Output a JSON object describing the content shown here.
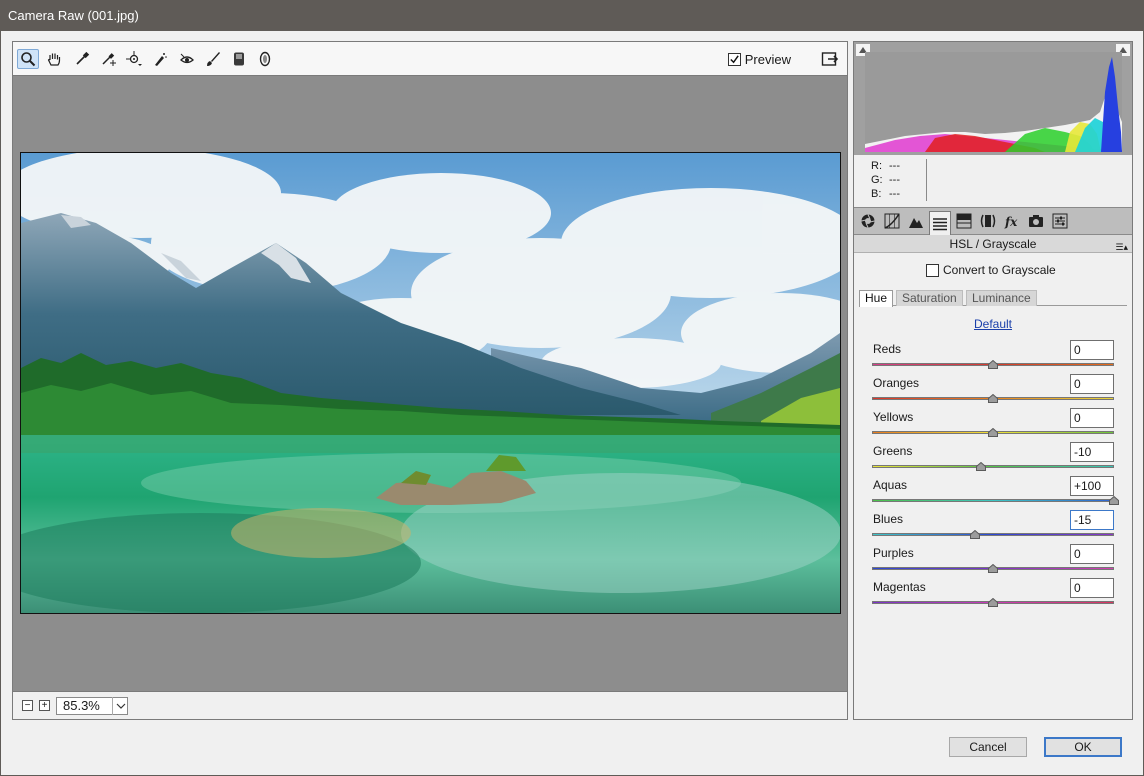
{
  "window": {
    "title": "Camera Raw (001.jpg)"
  },
  "toolbar": {
    "tools": [
      {
        "name": "zoom-tool",
        "icon": "magnifier-icon",
        "active": true
      },
      {
        "name": "hand-tool",
        "icon": "hand-icon"
      },
      {
        "name": "white-balance-tool",
        "icon": "eyedropper-icon"
      },
      {
        "name": "color-sampler-tool",
        "icon": "color-sampler-icon"
      },
      {
        "name": "targeted-adjustment-tool",
        "icon": "target-adjust-icon"
      },
      {
        "name": "spot-removal-tool",
        "icon": "spot-removal-icon"
      },
      {
        "name": "red-eye-tool",
        "icon": "red-eye-icon"
      },
      {
        "name": "adjustment-brush-tool",
        "icon": "brush-icon"
      },
      {
        "name": "graduated-filter-tool",
        "icon": "graduated-filter-icon"
      },
      {
        "name": "radial-filter-tool",
        "icon": "radial-filter-icon"
      }
    ],
    "preview_label": "Preview",
    "preview_checked": true
  },
  "zoom": {
    "value": "85.3%"
  },
  "readout": {
    "r_label": "R:",
    "r_value": "---",
    "g_label": "G:",
    "g_value": "---",
    "b_label": "B:",
    "b_value": "---"
  },
  "panel": {
    "title": "HSL / Grayscale",
    "grayscale_label": "Convert to Grayscale",
    "tabs": [
      "Hue",
      "Saturation",
      "Luminance"
    ],
    "active_tab": "Hue",
    "default_link": "Default",
    "sliders": [
      {
        "label": "Reds",
        "value": "0",
        "pos": 0,
        "colors": [
          "#d43f8a",
          "#d43b2c",
          "#e26b1a"
        ]
      },
      {
        "label": "Oranges",
        "value": "0",
        "pos": 0,
        "colors": [
          "#d9352c",
          "#e8821f",
          "#e9d53a"
        ]
      },
      {
        "label": "Yellows",
        "value": "0",
        "pos": 0,
        "colors": [
          "#e97d1f",
          "#f0e23a",
          "#6cc53a"
        ]
      },
      {
        "label": "Greens",
        "value": "-10",
        "pos": -10,
        "colors": [
          "#e9e33a",
          "#53c24a",
          "#39c4b6"
        ]
      },
      {
        "label": "Aquas",
        "value": "+100",
        "pos": 100,
        "colors": [
          "#4dc249",
          "#3cc5c2",
          "#2f63d2"
        ]
      },
      {
        "label": "Blues",
        "value": "-15",
        "pos": -15,
        "focused": true,
        "colors": [
          "#3ec5c7",
          "#2c48d4",
          "#8a36c6"
        ]
      },
      {
        "label": "Purples",
        "value": "0",
        "pos": 0,
        "colors": [
          "#2d4ad3",
          "#7d35c7",
          "#d33fae"
        ]
      },
      {
        "label": "Magentas",
        "value": "0",
        "pos": 0,
        "colors": [
          "#7a35c7",
          "#c93bb8",
          "#d8365f"
        ]
      }
    ]
  },
  "buttons": {
    "cancel": "Cancel",
    "ok": "OK"
  }
}
